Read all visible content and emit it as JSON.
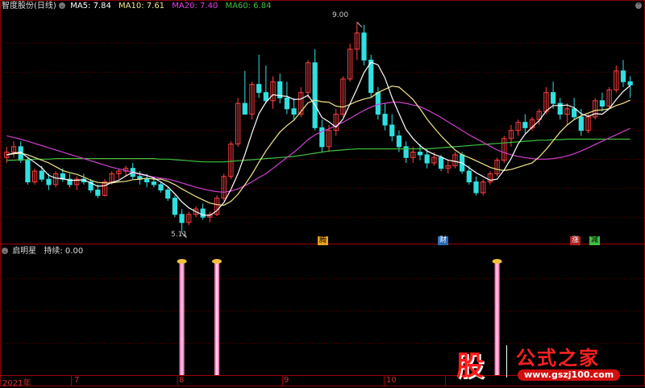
{
  "main_header": {
    "title": "智度股份(日线)",
    "indicators": [
      {
        "label": "MA5: 7.84",
        "color": "#ffffff"
      },
      {
        "label": "MA10: 7.61",
        "color": "#f3e88a"
      },
      {
        "label": "MA20: 7.40",
        "color": "#e040e0"
      },
      {
        "label": "MA60: 6.84",
        "color": "#40c040"
      }
    ]
  },
  "sub_header": {
    "title": "启明星",
    "value": "持续: 0.00"
  },
  "annotations": {
    "high": "9.00",
    "low": "5.11"
  },
  "event_tags": [
    {
      "text": "腾",
      "color": "#e8a020"
    },
    {
      "text": "财",
      "color": "#4a90e2"
    },
    {
      "text": "涨",
      "color": "#e04040"
    },
    {
      "text": "减",
      "color": "#40c040"
    }
  ],
  "x_axis": {
    "labels": [
      "2021年",
      "7",
      "8",
      "9",
      "10"
    ]
  },
  "watermark": {
    "left": "股",
    "right": "公式之家",
    "url": "www.gszj100.com"
  },
  "colors": {
    "up": "#ff4040",
    "down": "#30e0e0",
    "grid": "#5a0000",
    "signal": "#ff80c0"
  },
  "chart_data": {
    "type": "candlestick",
    "ohlc": [
      [
        6.5,
        6.7,
        6.4,
        6.6
      ],
      [
        6.6,
        6.8,
        6.5,
        6.7
      ],
      [
        6.7,
        6.8,
        6.4,
        6.45
      ],
      [
        6.45,
        6.5,
        6.0,
        6.05
      ],
      [
        6.05,
        6.3,
        6.0,
        6.25
      ],
      [
        6.25,
        6.35,
        6.05,
        6.1
      ],
      [
        6.1,
        6.2,
        5.9,
        6.0
      ],
      [
        6.0,
        6.25,
        5.95,
        6.2
      ],
      [
        6.2,
        6.3,
        6.05,
        6.1
      ],
      [
        6.1,
        6.2,
        5.95,
        6.0
      ],
      [
        6.0,
        6.15,
        5.9,
        6.1
      ],
      [
        6.1,
        6.2,
        6.0,
        6.05
      ],
      [
        6.05,
        6.1,
        5.85,
        5.9
      ],
      [
        5.9,
        6.0,
        5.75,
        5.8
      ],
      [
        5.8,
        6.1,
        5.78,
        6.05
      ],
      [
        6.05,
        6.25,
        6.0,
        6.2
      ],
      [
        6.2,
        6.3,
        6.1,
        6.25
      ],
      [
        6.25,
        6.35,
        6.15,
        6.3
      ],
      [
        6.3,
        6.4,
        6.1,
        6.15
      ],
      [
        6.15,
        6.25,
        6.0,
        6.1
      ],
      [
        6.1,
        6.2,
        5.95,
        6.05
      ],
      [
        6.05,
        6.15,
        5.95,
        6.0
      ],
      [
        6.0,
        6.05,
        5.85,
        5.9
      ],
      [
        5.9,
        5.95,
        5.7,
        5.75
      ],
      [
        5.75,
        5.8,
        5.4,
        5.45
      ],
      [
        5.45,
        5.55,
        5.11,
        5.3
      ],
      [
        5.3,
        5.5,
        5.25,
        5.45
      ],
      [
        5.45,
        5.6,
        5.4,
        5.55
      ],
      [
        5.55,
        5.65,
        5.35,
        5.4
      ],
      [
        5.4,
        5.5,
        5.3,
        5.45
      ],
      [
        5.45,
        5.8,
        5.42,
        5.75
      ],
      [
        5.75,
        6.2,
        5.7,
        6.15
      ],
      [
        6.15,
        6.8,
        6.1,
        6.75
      ],
      [
        6.75,
        7.6,
        6.7,
        7.5
      ],
      [
        7.5,
        8.1,
        7.4,
        7.3
      ],
      [
        7.3,
        7.9,
        7.2,
        7.85
      ],
      [
        7.85,
        8.4,
        7.6,
        7.7
      ],
      [
        7.7,
        8.2,
        7.5,
        7.55
      ],
      [
        7.55,
        8.0,
        7.4,
        7.9
      ],
      [
        7.9,
        8.05,
        7.5,
        7.6
      ],
      [
        7.6,
        7.9,
        7.3,
        7.4
      ],
      [
        7.4,
        7.6,
        7.2,
        7.3
      ],
      [
        7.3,
        7.8,
        7.25,
        7.7
      ],
      [
        7.7,
        8.3,
        7.6,
        8.25
      ],
      [
        8.25,
        8.5,
        7.0,
        7.05
      ],
      [
        7.05,
        7.2,
        6.6,
        6.7
      ],
      [
        6.7,
        7.1,
        6.6,
        7.0
      ],
      [
        7.0,
        7.4,
        6.9,
        7.3
      ],
      [
        7.3,
        8.0,
        7.25,
        7.95
      ],
      [
        7.95,
        8.6,
        7.9,
        8.5
      ],
      [
        8.5,
        9.0,
        8.3,
        8.8
      ],
      [
        8.8,
        8.95,
        8.2,
        8.3
      ],
      [
        8.3,
        8.4,
        7.6,
        7.7
      ],
      [
        7.7,
        7.8,
        7.2,
        7.3
      ],
      [
        7.3,
        7.5,
        7.0,
        7.1
      ],
      [
        7.1,
        7.3,
        6.8,
        6.9
      ],
      [
        6.9,
        7.0,
        6.6,
        6.7
      ],
      [
        6.7,
        6.8,
        6.4,
        6.5
      ],
      [
        6.5,
        6.7,
        6.4,
        6.6
      ],
      [
        6.6,
        6.75,
        6.45,
        6.55
      ],
      [
        6.55,
        6.65,
        6.3,
        6.4
      ],
      [
        6.4,
        6.6,
        6.35,
        6.5
      ],
      [
        6.5,
        6.55,
        6.25,
        6.3
      ],
      [
        6.3,
        6.45,
        6.2,
        6.35
      ],
      [
        6.35,
        6.6,
        6.3,
        6.55
      ],
      [
        6.55,
        6.6,
        6.2,
        6.25
      ],
      [
        6.25,
        6.35,
        6.0,
        6.05
      ],
      [
        6.05,
        6.15,
        5.8,
        5.85
      ],
      [
        5.85,
        6.1,
        5.8,
        6.05
      ],
      [
        6.05,
        6.25,
        6.0,
        6.2
      ],
      [
        6.2,
        6.5,
        6.15,
        6.45
      ],
      [
        6.45,
        6.9,
        6.4,
        6.85
      ],
      [
        6.85,
        7.1,
        6.7,
        7.0
      ],
      [
        7.0,
        7.2,
        6.9,
        7.15
      ],
      [
        7.15,
        7.3,
        6.95,
        7.05
      ],
      [
        7.05,
        7.25,
        7.0,
        7.2
      ],
      [
        7.2,
        7.4,
        7.1,
        7.35
      ],
      [
        7.35,
        7.8,
        7.3,
        7.7
      ],
      [
        7.7,
        7.9,
        7.4,
        7.5
      ],
      [
        7.5,
        7.6,
        7.2,
        7.3
      ],
      [
        7.3,
        7.5,
        7.1,
        7.4
      ],
      [
        7.4,
        7.6,
        7.2,
        7.25
      ],
      [
        7.25,
        7.4,
        6.9,
        7.0
      ],
      [
        7.0,
        7.3,
        6.95,
        7.25
      ],
      [
        7.25,
        7.6,
        7.2,
        7.55
      ],
      [
        7.55,
        7.7,
        7.35,
        7.45
      ],
      [
        7.45,
        7.8,
        7.4,
        7.75
      ],
      [
        7.75,
        8.2,
        7.7,
        8.1
      ],
      [
        8.1,
        8.3,
        7.8,
        7.9
      ],
      [
        7.9,
        8.0,
        7.6,
        7.84
      ]
    ],
    "ma5": [
      6.55,
      6.58,
      6.6,
      6.5,
      6.41,
      6.31,
      6.17,
      6.12,
      6.11,
      6.08,
      6.08,
      6.09,
      6.03,
      5.97,
      5.98,
      6.04,
      6.08,
      6.16,
      6.23,
      6.2,
      6.17,
      6.12,
      6.05,
      5.96,
      5.83,
      5.68,
      5.57,
      5.5,
      5.44,
      5.43,
      5.52,
      5.67,
      5.91,
      6.2,
      6.56,
      6.95,
      7.31,
      7.52,
      7.66,
      7.64,
      7.63,
      7.57,
      7.58,
      7.65,
      7.47,
      7.24,
      7.16,
      7.06,
      7.21,
      7.49,
      7.77,
      8.07,
      8.26,
      8.21,
      7.97,
      7.61,
      7.31,
      7.02,
      6.85,
      6.72,
      6.62,
      6.56,
      6.51,
      6.45,
      6.43,
      6.4,
      6.31,
      6.22,
      6.15,
      6.08,
      6.1,
      6.27,
      6.48,
      6.75,
      6.93,
      7.06,
      7.18,
      7.36,
      7.46,
      7.46,
      7.47,
      7.42,
      7.31,
      7.26,
      7.31,
      7.3,
      7.4,
      7.57,
      7.72,
      7.83
    ],
    "ma10": [
      6.55,
      6.57,
      6.58,
      6.55,
      6.5,
      6.45,
      6.4,
      6.33,
      6.26,
      6.22,
      6.19,
      6.14,
      6.08,
      6.04,
      6.03,
      6.03,
      6.05,
      6.06,
      6.09,
      6.1,
      6.12,
      6.1,
      6.1,
      6.06,
      6.0,
      5.92,
      5.85,
      5.78,
      5.72,
      5.66,
      5.63,
      5.62,
      5.69,
      5.82,
      6.0,
      6.19,
      6.41,
      6.62,
      6.8,
      6.97,
      7.09,
      7.19,
      7.35,
      7.51,
      7.56,
      7.53,
      7.52,
      7.45,
      7.43,
      7.48,
      7.54,
      7.58,
      7.61,
      7.7,
      7.76,
      7.82,
      7.8,
      7.69,
      7.57,
      7.4,
      7.21,
      7.05,
      6.9,
      6.77,
      6.64,
      6.55,
      6.5,
      6.44,
      6.38,
      6.32,
      6.28,
      6.26,
      6.28,
      6.32,
      6.36,
      6.4,
      6.51,
      6.65,
      6.81,
      6.97,
      7.1,
      7.2,
      7.27,
      7.32,
      7.37,
      7.38,
      7.4,
      7.46,
      7.5,
      7.56
    ],
    "ma20": [
      6.9,
      6.87,
      6.84,
      6.8,
      6.76,
      6.72,
      6.68,
      6.64,
      6.6,
      6.56,
      6.52,
      6.48,
      6.44,
      6.4,
      6.36,
      6.32,
      6.29,
      6.26,
      6.22,
      6.19,
      6.16,
      6.14,
      6.12,
      6.1,
      6.07,
      6.03,
      5.99,
      5.95,
      5.92,
      5.89,
      5.87,
      5.86,
      5.88,
      5.92,
      5.98,
      6.05,
      6.13,
      6.2,
      6.3,
      6.4,
      6.5,
      6.6,
      6.71,
      6.83,
      6.92,
      6.98,
      7.03,
      7.09,
      7.15,
      7.22,
      7.3,
      7.37,
      7.43,
      7.48,
      7.5,
      7.52,
      7.52,
      7.5,
      7.47,
      7.44,
      7.38,
      7.31,
      7.24,
      7.16,
      7.08,
      7.0,
      6.92,
      6.85,
      6.78,
      6.71,
      6.64,
      6.59,
      6.55,
      6.52,
      6.5,
      6.48,
      6.47,
      6.47,
      6.48,
      6.5,
      6.53,
      6.57,
      6.62,
      6.68,
      6.74,
      6.8,
      6.86,
      6.92,
      6.98,
      7.04
    ],
    "ma60": [
      6.45,
      6.45,
      6.46,
      6.46,
      6.47,
      6.47,
      6.47,
      6.48,
      6.48,
      6.48,
      6.48,
      6.48,
      6.48,
      6.48,
      6.48,
      6.48,
      6.48,
      6.48,
      6.48,
      6.48,
      6.48,
      6.48,
      6.47,
      6.47,
      6.46,
      6.45,
      6.44,
      6.43,
      6.42,
      6.42,
      6.42,
      6.42,
      6.43,
      6.44,
      6.45,
      6.46,
      6.47,
      6.48,
      6.49,
      6.5,
      6.51,
      6.52,
      6.54,
      6.56,
      6.58,
      6.6,
      6.62,
      6.63,
      6.64,
      6.65,
      6.66,
      6.66,
      6.66,
      6.66,
      6.66,
      6.66,
      6.66,
      6.66,
      6.66,
      6.66,
      6.66,
      6.67,
      6.68,
      6.69,
      6.7,
      6.71,
      6.72,
      6.73,
      6.74,
      6.75,
      6.76,
      6.77,
      6.78,
      6.79,
      6.8,
      6.81,
      6.82,
      6.82,
      6.83,
      6.83,
      6.84,
      6.84,
      6.84,
      6.84,
      6.84,
      6.84,
      6.84,
      6.84,
      6.84,
      6.84
    ],
    "signals": [
      25,
      30,
      70
    ],
    "ylim": [
      5.0,
      9.2
    ]
  }
}
